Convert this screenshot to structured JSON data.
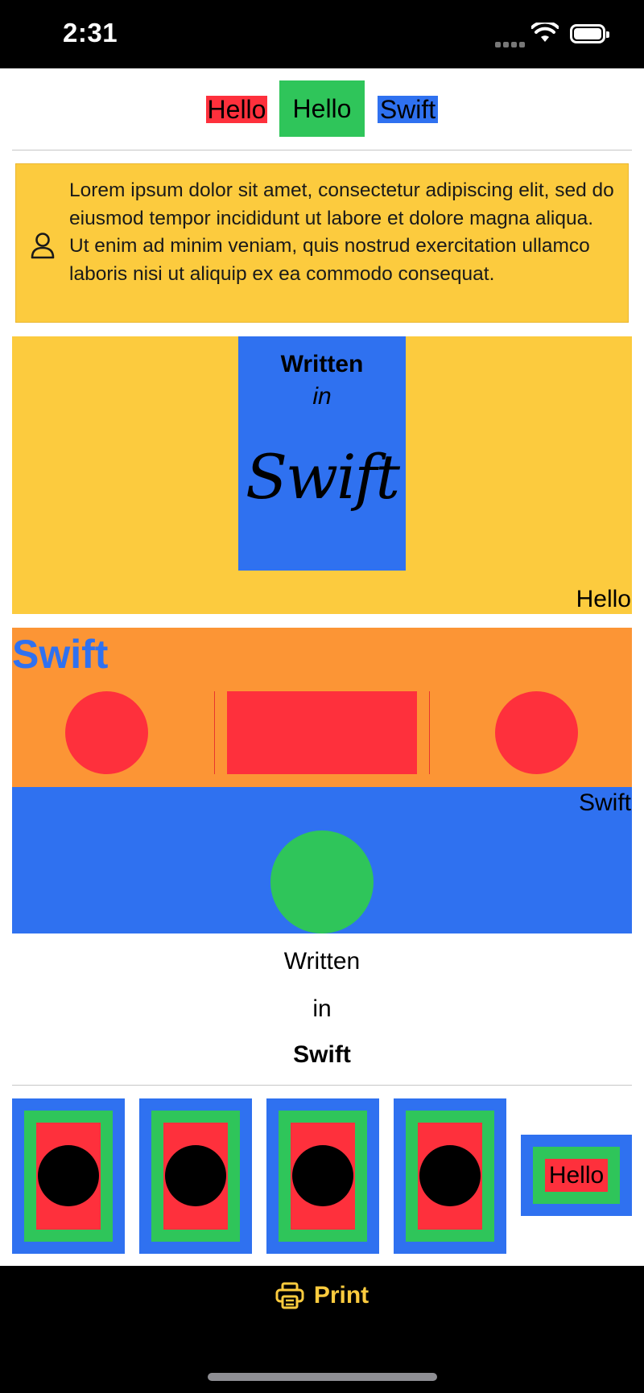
{
  "status_bar": {
    "time": "2:31"
  },
  "hello_row": [
    {
      "label": "Hello",
      "bg": "#fe303c"
    },
    {
      "label": "Hello",
      "bg": "#2fc55a"
    },
    {
      "label": "Swift",
      "bg": "#2f71f0"
    }
  ],
  "callout": {
    "icon": "person-icon",
    "text": "Lorem ipsum dolor sit amet, consectetur adipiscing elit, sed do eiusmod tempor incididunt ut labore et dolore magna aliqua. Ut enim ad minim veniam, quis nostrud exercitation ullamco laboris nisi ut aliquip ex ea commodo consequat."
  },
  "written_card": {
    "line1": "Written",
    "line2": "in",
    "line3": "Swift"
  },
  "yellow_corner_label": "Hello",
  "orange_section": {
    "title": "Swift"
  },
  "blue_corner_label": "Swift",
  "stack_text": {
    "line1": "Written",
    "line2": "in",
    "line3": "Swift"
  },
  "small_card_label": "Hello",
  "toolbar": {
    "print_icon": "printer-icon",
    "print_label": "Print"
  },
  "colors": {
    "yellow": "#fccb3e",
    "orange": "#fc9535",
    "blue": "#2f71f0",
    "green": "#2fc55a",
    "red": "#fe303c"
  }
}
